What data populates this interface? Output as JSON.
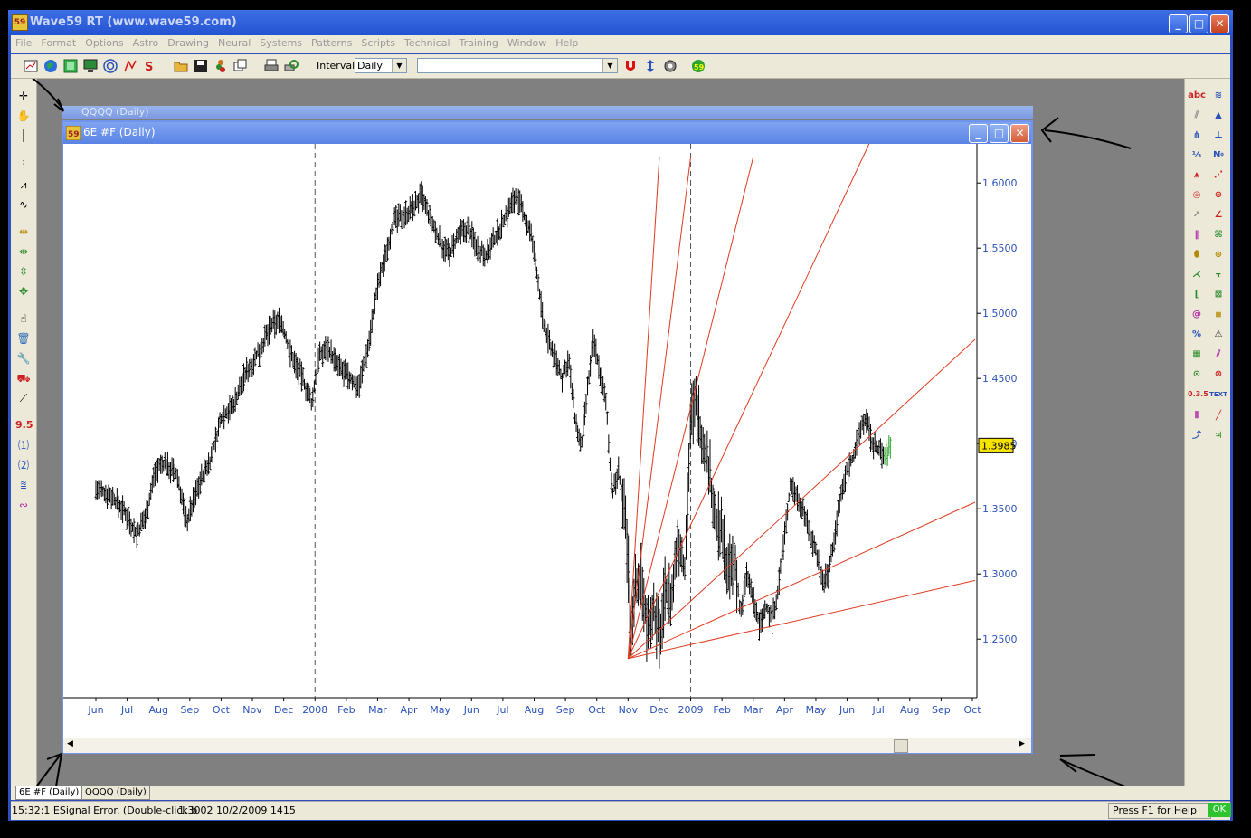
{
  "app": {
    "title": "Wave59 RT (www.wave59.com)",
    "icon_label": "59",
    "controls": {
      "minimize": "_",
      "maximize": "□",
      "close": "✕"
    }
  },
  "menu": [
    "File",
    "Format",
    "Options",
    "Astro",
    "Drawing",
    "Neural",
    "Systems",
    "Patterns",
    "Scripts",
    "Technical",
    "Training",
    "Window",
    "Help"
  ],
  "toolbar": {
    "interval_label": "Interval:",
    "interval_value": "Daily",
    "symbol_value": ""
  },
  "right_tools": {
    "abc": "abc",
    "num": "0.3.5",
    "text": "TEXT",
    "pct": "%"
  },
  "left_tools": {
    "wave_95": "9.5"
  },
  "chart_window": {
    "back_title": "QQQQ (Daily)",
    "title": "6E #F (Daily)",
    "price_label": "1.3985"
  },
  "chart_data": {
    "type": "line",
    "style": "ohlc-bar",
    "symbol": "6E #F",
    "interval": "Daily",
    "x_ticks": [
      "Jun",
      "Jul",
      "Aug",
      "Sep",
      "Oct",
      "Nov",
      "Dec",
      "2008",
      "Feb",
      "Mar",
      "Apr",
      "May",
      "Jun",
      "Jul",
      "Aug",
      "Sep",
      "Oct",
      "Nov",
      "Dec",
      "2009",
      "Feb",
      "Mar",
      "Apr",
      "May",
      "Jun",
      "Jul",
      "Aug",
      "Sep",
      "Oct"
    ],
    "y_ticks": [
      "1.6000",
      "1.5500",
      "1.5000",
      "1.4500",
      "1.4000",
      "1.3500",
      "1.3000",
      "1.2500"
    ],
    "ylim": [
      1.205,
      1.63
    ],
    "last_price": 1.3985,
    "vertical_markers": [
      "2008",
      "2009"
    ],
    "series": [
      {
        "values": [
          [
            0,
            1.365
          ],
          [
            0.5,
            1.36
          ],
          [
            1,
            1.345
          ],
          [
            1.3,
            1.33
          ],
          [
            1.6,
            1.345
          ],
          [
            1.9,
            1.38
          ],
          [
            2.2,
            1.385
          ],
          [
            2.6,
            1.375
          ],
          [
            2.9,
            1.34
          ],
          [
            3.3,
            1.37
          ],
          [
            3.7,
            1.39
          ],
          [
            4.0,
            1.42
          ],
          [
            4.4,
            1.43
          ],
          [
            4.8,
            1.455
          ],
          [
            5.2,
            1.47
          ],
          [
            5.6,
            1.49
          ],
          [
            5.9,
            1.495
          ],
          [
            6.2,
            1.47
          ],
          [
            6.6,
            1.45
          ],
          [
            6.9,
            1.43
          ],
          [
            7.1,
            1.465
          ],
          [
            7.4,
            1.475
          ],
          [
            7.7,
            1.46
          ],
          [
            8.1,
            1.45
          ],
          [
            8.4,
            1.445
          ],
          [
            8.7,
            1.475
          ],
          [
            9.0,
            1.52
          ],
          [
            9.3,
            1.55
          ],
          [
            9.5,
            1.57
          ],
          [
            9.8,
            1.575
          ],
          [
            10.1,
            1.58
          ],
          [
            10.4,
            1.59
          ],
          [
            10.7,
            1.57
          ],
          [
            11.0,
            1.555
          ],
          [
            11.3,
            1.545
          ],
          [
            11.6,
            1.56
          ],
          [
            11.9,
            1.565
          ],
          [
            12.2,
            1.55
          ],
          [
            12.5,
            1.545
          ],
          [
            12.8,
            1.56
          ],
          [
            13.1,
            1.575
          ],
          [
            13.4,
            1.59
          ],
          [
            13.6,
            1.58
          ],
          [
            13.9,
            1.56
          ],
          [
            14.1,
            1.53
          ],
          [
            14.3,
            1.49
          ],
          [
            14.6,
            1.47
          ],
          [
            14.9,
            1.45
          ],
          [
            15.1,
            1.465
          ],
          [
            15.3,
            1.42
          ],
          [
            15.5,
            1.395
          ],
          [
            15.7,
            1.44
          ],
          [
            15.9,
            1.48
          ],
          [
            16.1,
            1.455
          ],
          [
            16.3,
            1.43
          ],
          [
            16.5,
            1.36
          ],
          [
            16.7,
            1.38
          ],
          [
            16.9,
            1.34
          ],
          [
            17.0,
            1.31
          ],
          [
            17.1,
            1.25
          ],
          [
            17.2,
            1.29
          ],
          [
            17.4,
            1.3
          ],
          [
            17.6,
            1.26
          ],
          [
            17.8,
            1.275
          ],
          [
            18.0,
            1.25
          ],
          [
            18.2,
            1.29
          ],
          [
            18.4,
            1.28
          ],
          [
            18.6,
            1.33
          ],
          [
            18.8,
            1.3
          ],
          [
            19.0,
            1.42
          ],
          [
            19.2,
            1.43
          ],
          [
            19.4,
            1.4
          ],
          [
            19.6,
            1.38
          ],
          [
            19.8,
            1.34
          ],
          [
            20.0,
            1.33
          ],
          [
            20.2,
            1.3
          ],
          [
            20.4,
            1.31
          ],
          [
            20.6,
            1.27
          ],
          [
            20.8,
            1.3
          ],
          [
            21.0,
            1.28
          ],
          [
            21.2,
            1.26
          ],
          [
            21.4,
            1.275
          ],
          [
            21.6,
            1.265
          ],
          [
            21.8,
            1.29
          ],
          [
            22.0,
            1.33
          ],
          [
            22.2,
            1.37
          ],
          [
            22.4,
            1.36
          ],
          [
            22.6,
            1.35
          ],
          [
            22.8,
            1.33
          ],
          [
            23.0,
            1.32
          ],
          [
            23.2,
            1.295
          ],
          [
            23.4,
            1.3
          ],
          [
            23.6,
            1.33
          ],
          [
            23.8,
            1.36
          ],
          [
            24.0,
            1.38
          ],
          [
            24.2,
            1.39
          ],
          [
            24.4,
            1.41
          ],
          [
            24.6,
            1.42
          ],
          [
            24.8,
            1.4
          ],
          [
            25.0,
            1.395
          ],
          [
            25.2,
            1.39
          ],
          [
            25.4,
            1.3985
          ]
        ]
      }
    ],
    "fan": {
      "origin": [
        17.0,
        1.235
      ],
      "endpoints": [
        [
          18.0,
          1.62
        ],
        [
          19.0,
          1.62
        ],
        [
          21.0,
          1.62
        ],
        [
          24.7,
          1.63
        ],
        [
          29.0,
          1.48
        ],
        [
          29.0,
          1.355
        ],
        [
          29.0,
          1.295
        ]
      ]
    }
  },
  "tabs": [
    "6E #F (Daily)",
    "QQQQ (Daily)"
  ],
  "status": {
    "message": "15:32:1 ESignal Error. (Double-click b",
    "quote": "1.3002  10/2/2009  1415",
    "help": "Press F1 for Help",
    "ok": "OK"
  },
  "colors": {
    "fan": "#e03a1f",
    "bars": "#000000",
    "title_blue": "#2353d0",
    "price_box": "#f7e300"
  }
}
